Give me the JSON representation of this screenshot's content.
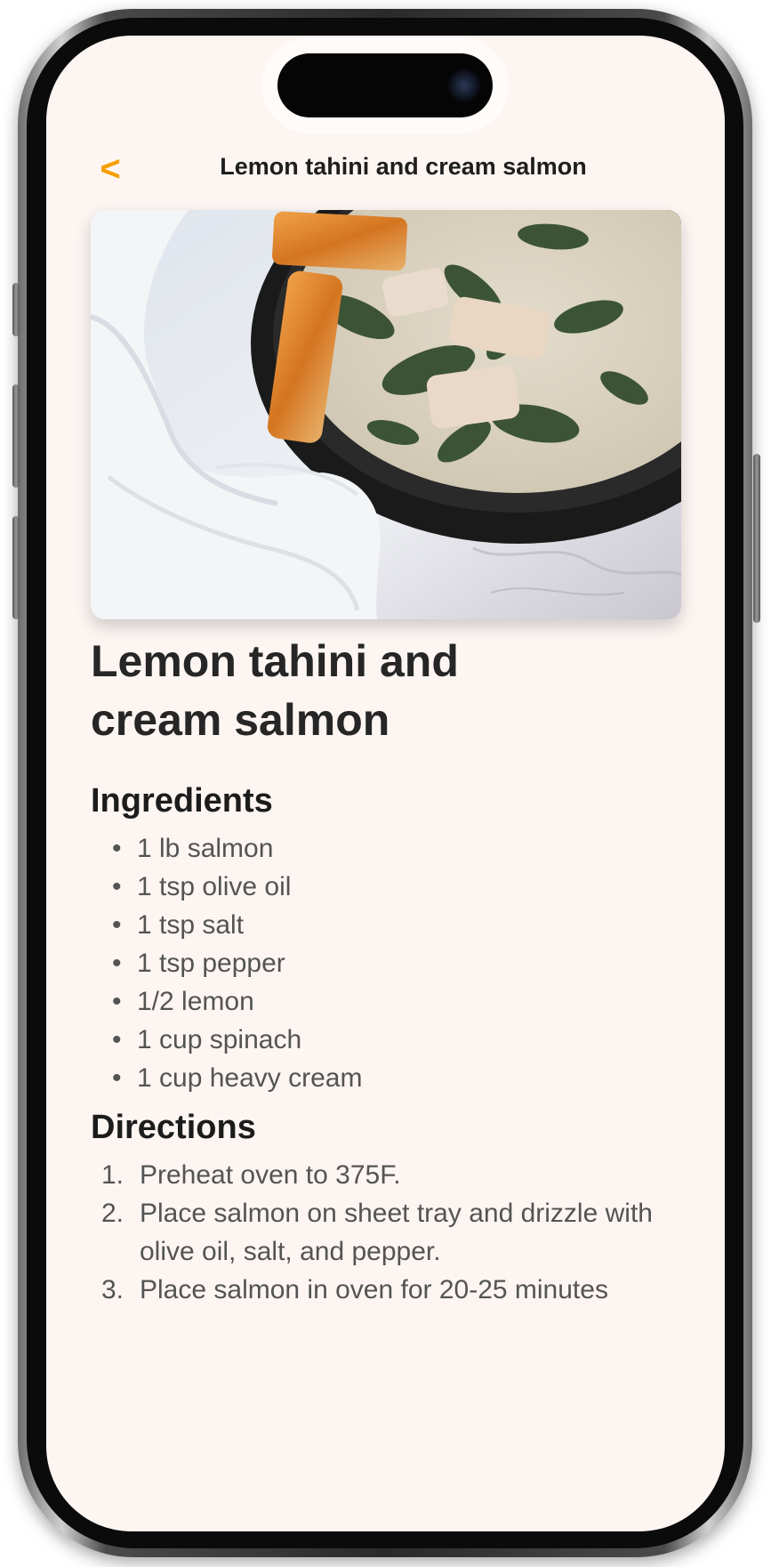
{
  "nav": {
    "back_label": "<",
    "title": "Lemon tahini and cream salmon"
  },
  "hero_image": {
    "description_icon": "salmon-skillet-photo"
  },
  "recipe": {
    "title": "Lemon tahini and cream salmon",
    "ingredients_heading": "Ingredients",
    "ingredients": [
      "1 lb salmon",
      "1 tsp olive oil",
      "1 tsp salt",
      "1 tsp pepper",
      "1/2 lemon",
      "1 cup spinach",
      "1 cup heavy cream"
    ],
    "directions_heading": "Directions",
    "directions": [
      "Preheat oven to 375F.",
      "Place salmon on sheet tray and drizzle with olive oil, salt, and pepper.",
      "Place salmon in oven for 20-25 minutes"
    ]
  },
  "colors": {
    "accent": "#f5a000",
    "screen_background": "#fdf5f2",
    "text_primary": "#262626",
    "text_secondary": "#545454"
  }
}
